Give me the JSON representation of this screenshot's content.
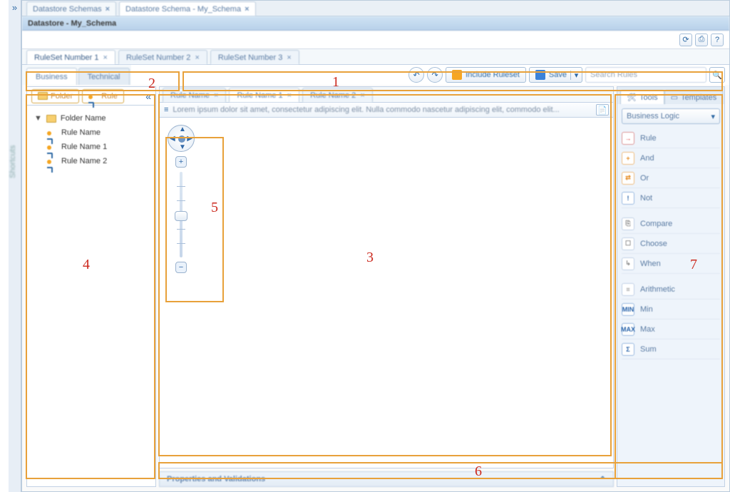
{
  "top_tabs": [
    {
      "label": "Datastore Schemas",
      "active": false
    },
    {
      "label": "Datastore Schema - My_Schema",
      "active": true
    }
  ],
  "title": "Datastore - My_Schema",
  "shortcuts_label": "Shortcuts",
  "ruleset_tabs": [
    {
      "label": "RuleSet Number 1",
      "active": true
    },
    {
      "label": "RuleSet Number 2",
      "active": false
    },
    {
      "label": "RuleSet Number 3",
      "active": false
    }
  ],
  "view_tabs": {
    "business": "Business",
    "technical": "Technical"
  },
  "cmd": {
    "include": "Include Ruleset",
    "save": "Save",
    "search_placeholder": "Search Rules"
  },
  "left": {
    "folder_tab": "Folder",
    "rule_tab": "Rule",
    "tree": {
      "folder": "Folder Name",
      "rules": [
        "Rule Name",
        "Rule Name 1",
        "Rule Name 2"
      ]
    }
  },
  "rule_tabs": [
    {
      "label": "Rule Name",
      "active": false
    },
    {
      "label": "Rule Name 1",
      "active": true
    },
    {
      "label": "Rule Name 2",
      "active": false
    }
  ],
  "description": "Lorem ipsum dolor sit amet, consectetur adipiscing elit. Nulla commodo nascetur adipiscing elit, commodo elit...",
  "props_label": "Properties and Validations",
  "right": {
    "tools_tab": "Tools",
    "templates_tab": "Templates",
    "dropdown": "Business Logic",
    "group1": [
      {
        "icon": "→",
        "cls": "red",
        "label": "Rule"
      },
      {
        "icon": "+",
        "cls": "orange",
        "label": "And"
      },
      {
        "icon": "⇄",
        "cls": "orange",
        "label": "Or"
      },
      {
        "icon": "!",
        "cls": "blue",
        "label": "Not"
      }
    ],
    "group2": [
      {
        "icon": "⎘",
        "cls": "gray",
        "label": "Compare"
      },
      {
        "icon": "☐",
        "cls": "gray",
        "label": "Choose"
      },
      {
        "icon": "↳",
        "cls": "gray",
        "label": "When"
      }
    ],
    "group3": [
      {
        "icon": "≡",
        "cls": "gray",
        "label": "Arithmetic"
      },
      {
        "icon": "MIN",
        "cls": "blue",
        "label": "Min"
      },
      {
        "icon": "MAX",
        "cls": "blue",
        "label": "Max"
      },
      {
        "icon": "Σ",
        "cls": "blue",
        "label": "Sum"
      }
    ]
  },
  "annotations": [
    "1",
    "2",
    "3",
    "4",
    "5",
    "6",
    "7"
  ]
}
